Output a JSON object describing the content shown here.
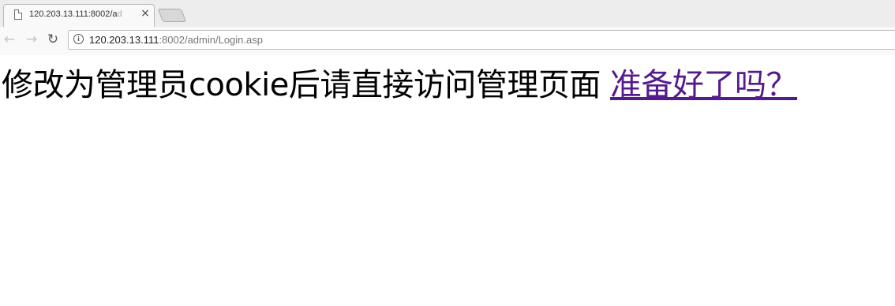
{
  "browser": {
    "tab": {
      "title": "120.203.13.111:8002/a",
      "title_fade": "d",
      "close_glyph": "×"
    },
    "nav": {
      "back_glyph": "←",
      "forward_glyph": "→",
      "reload_glyph": "↻"
    },
    "address_bar": {
      "info_glyph": "i",
      "host": "120.203.13.111",
      "path": ":8002/admin/Login.asp"
    }
  },
  "page": {
    "message": "修改为管理员cookie后请直接访问管理页面 ",
    "link_text": "准备好了吗？",
    "link_color": "#551a8b",
    "text_color": "#000000"
  }
}
